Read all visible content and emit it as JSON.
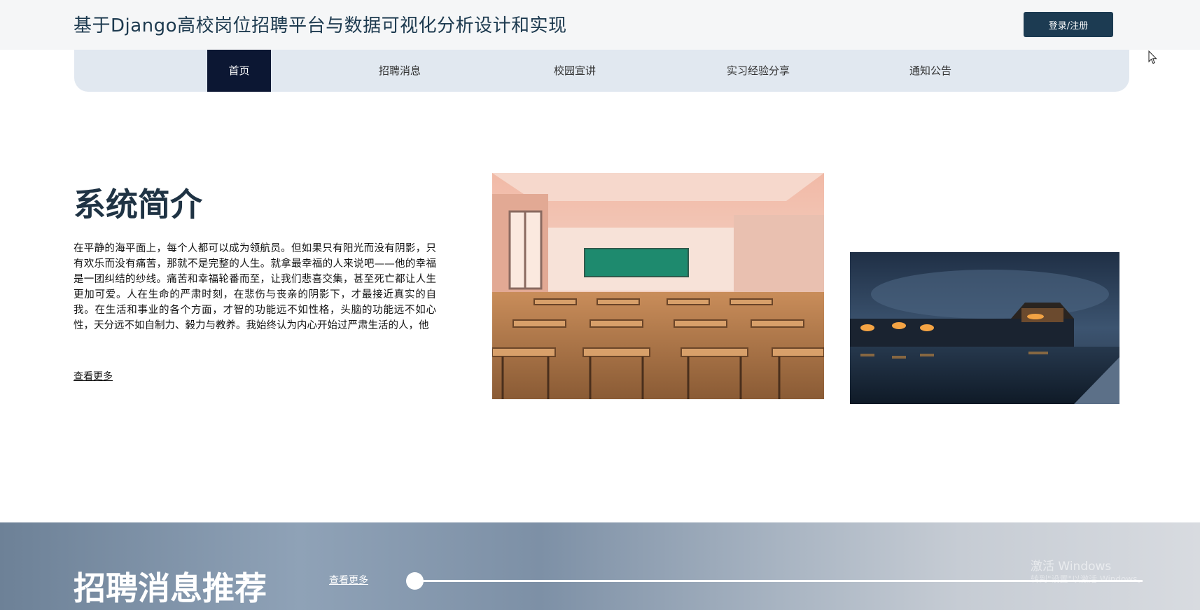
{
  "header": {
    "title": "基于Django高校岗位招聘平台与数据可视化分析设计和实现",
    "login_label": "登录/注册"
  },
  "nav": {
    "items": [
      {
        "label": "首页",
        "active": true
      },
      {
        "label": "招聘消息",
        "active": false
      },
      {
        "label": "校园宣讲",
        "active": false
      },
      {
        "label": "实习经验分享",
        "active": false
      },
      {
        "label": "通知公告",
        "active": false
      }
    ]
  },
  "intro": {
    "title": "系统简介",
    "text": "在平静的海平面上，每个人都可以成为领航员。但如果只有阳光而没有阴影，只有欢乐而没有痛苦，那就不是完整的人生。就拿最幸福的人来说吧——他的幸福是一团纠结的纱线。痛苦和幸福轮番而至，让我们悲喜交集，甚至死亡都让人生更加可爱。人在生命的严肃时刻，在悲伤与丧亲的阴影下，才最接近真实的自我。在生活和事业的各个方面，才智的功能远不如性格，头脑的功能远不如心性，天分远不如自制力、毅力与教养。我始终认为内心开始过严肃生活的人，他",
    "more_label": "查看更多",
    "images": [
      "classroom-image",
      "palace-night-image"
    ]
  },
  "recommend": {
    "title": "招聘消息推荐",
    "more_label": "查看更多",
    "slider_value": 0
  },
  "watermark": {
    "line1": "激活 Windows",
    "line2": "转到\"设置\"以激活 Windows。"
  },
  "colors": {
    "header_bg": "#f5f6f7",
    "nav_bg": "#e1e8f0",
    "nav_active": "#0c1733",
    "login_btn": "#1c3b52",
    "title_text": "#1d3a4f"
  }
}
